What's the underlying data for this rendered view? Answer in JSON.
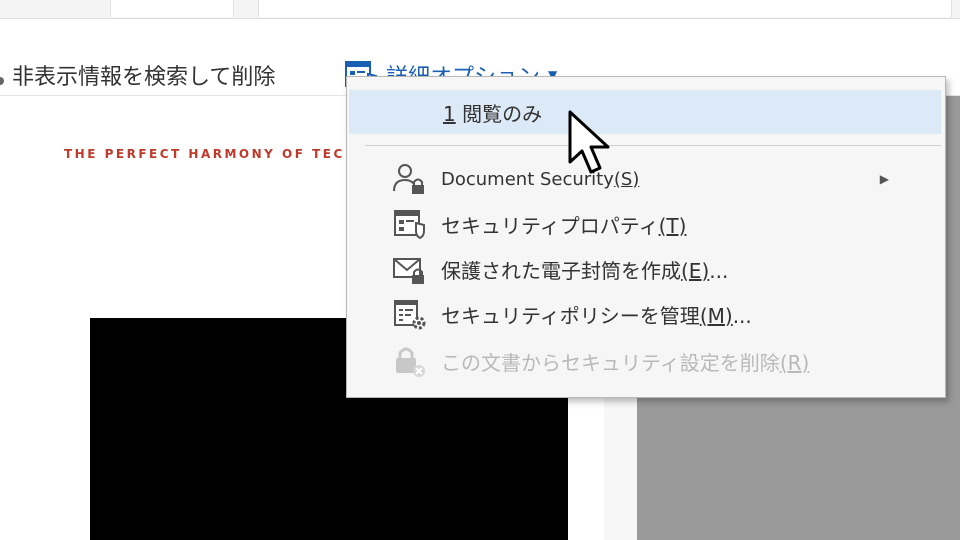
{
  "toolbar": {
    "remove_hidden_label": "非表示情報を検索して削除",
    "advanced_options_label": "詳細オプション"
  },
  "document": {
    "tagline": "THE PERFECT HARMONY OF TEC"
  },
  "menu": {
    "recent_item": {
      "number": "1",
      "label": "閲覧のみ"
    },
    "items": [
      {
        "label": "Document Security",
        "key": "(S)",
        "icon": "user-lock-icon",
        "has_submenu": true
      },
      {
        "label": "セキュリティプロパティ",
        "key": "(T)",
        "icon": "security-properties-icon"
      },
      {
        "label": "保護された電子封筒を作成",
        "key": "(E)",
        "suffix": "...",
        "icon": "envelope-lock-icon"
      },
      {
        "label": "セキュリティポリシーを管理",
        "key": "(M)",
        "suffix": "...",
        "icon": "policy-gear-icon"
      },
      {
        "label": "この文書からセキュリティ設定を削除",
        "key": "(R)",
        "icon": "lock-remove-icon",
        "disabled": true
      }
    ]
  },
  "colors": {
    "accent": "#1a5fb4",
    "highlight": "#dce9f6",
    "tagline": "#c0392b"
  }
}
